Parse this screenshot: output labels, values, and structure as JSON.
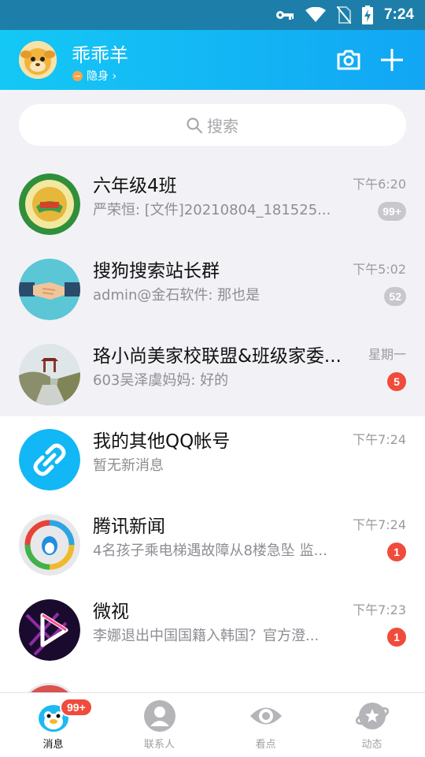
{
  "status_bar": {
    "time": "7:24",
    "icons": [
      "vpn-key-icon",
      "wifi-icon",
      "no-sim-icon",
      "battery-charging-icon"
    ]
  },
  "header": {
    "username": "乖乖羊",
    "presence": "隐身 ›",
    "icons": {
      "camera": "camera-icon",
      "add": "plus-icon"
    }
  },
  "search": {
    "placeholder": "搜索",
    "icon": "search-icon"
  },
  "conversations": [
    {
      "title": "六年级4班",
      "preview": "严荣恒: [文件]20210804_181525...",
      "time": "下午6:20",
      "badge": "99+",
      "badge_style": "gray",
      "avatar": "school-logo-avatar"
    },
    {
      "title": "搜狗搜索站长群",
      "preview": "admin@金石软件: 那也是",
      "time": "下午5:02",
      "badge": "52",
      "badge_style": "gray",
      "avatar": "handshake-avatar"
    },
    {
      "title": "珞小尚美家校联盟&班级家委...",
      "preview": "603吴泽虞妈妈: 好的",
      "time": "星期一",
      "badge": "5",
      "badge_style": "red",
      "avatar": "pavilion-photo-avatar"
    },
    {
      "title": "我的其他QQ帐号",
      "preview": "暂无新消息",
      "time": "下午7:24",
      "badge": "",
      "badge_style": "",
      "avatar": "link-icon-avatar"
    },
    {
      "title": "腾讯新闻",
      "preview": "4名孩子乘电梯遇故障从8楼急坠 监...",
      "time": "下午7:24",
      "badge": "1",
      "badge_style": "red",
      "avatar": "tencent-news-avatar"
    },
    {
      "title": "微视",
      "preview": "李娜退出中国国籍入韩国？官方澄...",
      "time": "下午7:23",
      "badge": "1",
      "badge_style": "red",
      "avatar": "weishi-avatar"
    }
  ],
  "tabbar": {
    "tabs": [
      {
        "label": "消息",
        "icon": "penguin-message-icon",
        "badge": "99+"
      },
      {
        "label": "联系人",
        "icon": "contacts-icon"
      },
      {
        "label": "看点",
        "icon": "eye-icon"
      },
      {
        "label": "动态",
        "icon": "planet-icon"
      }
    ]
  },
  "colors": {
    "header_start": "#14c8f5",
    "header_end": "#12a6f4",
    "badge_red": "#f04b3b",
    "badge_gray": "#c7c7cc",
    "status_bar": "#1d7fa9"
  }
}
